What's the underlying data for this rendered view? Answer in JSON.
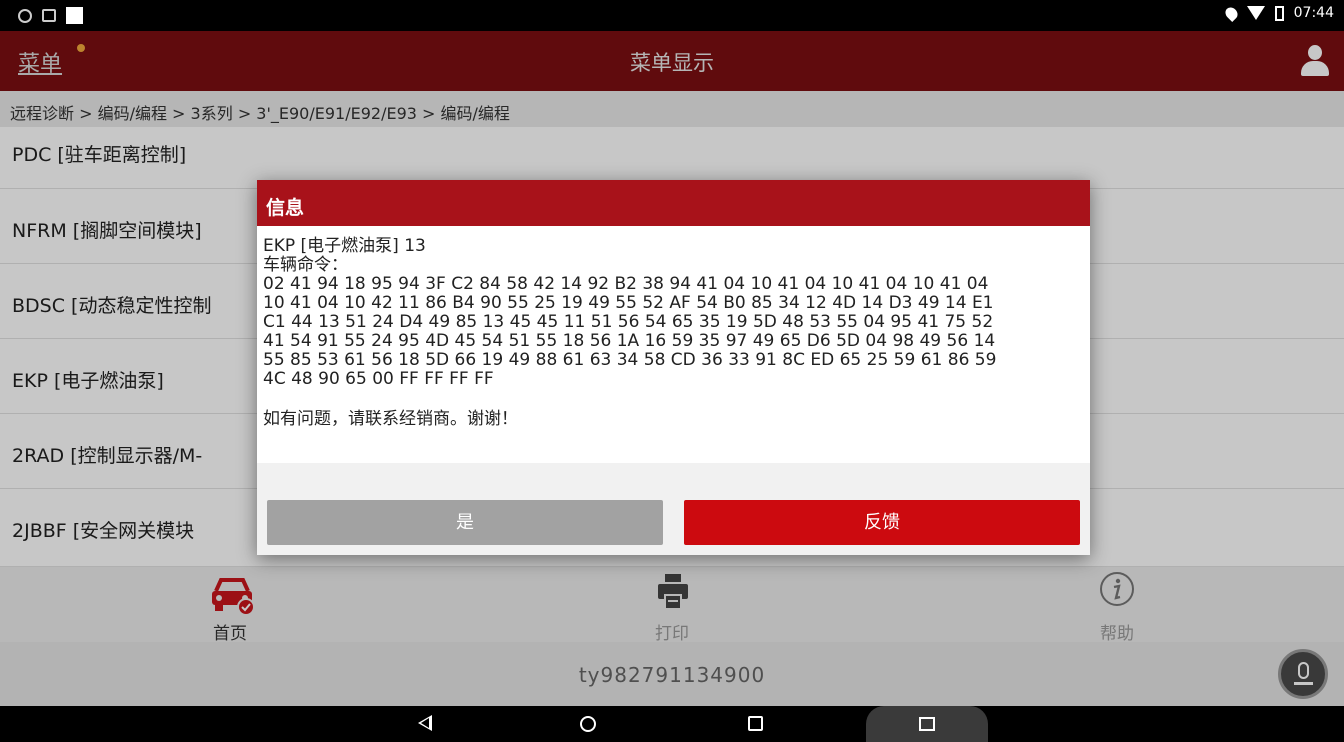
{
  "status_bar": {
    "time": "07:44"
  },
  "header": {
    "menu_label": "菜单",
    "title": "菜单显示"
  },
  "breadcrumb": "远程诊断 > 编码/编程 > 3系列 > 3'_E90/E91/E92/E93 > 编码/编程",
  "list_items": [
    "PDC [驻车距离控制]",
    "NFRM [搁脚空间模块]",
    "BDSC [动态稳定性控制",
    "EKP [电子燃油泵]",
    "2RAD [控制显示器/M-",
    "2JBBF [安全网关模块"
  ],
  "bottom_nav": {
    "home": "首页",
    "print": "打印",
    "help": "帮助"
  },
  "account": "ty982791134900",
  "dialog": {
    "title": "信息",
    "line1": "EKP [电子燃油泵] 13",
    "line2": "车辆命令：",
    "hex_lines": [
      "02 41 94 18 95 94 3F C2 84 58 42 14 92 B2 38 94 41 04 10 41 04 10 41 04 10 41 04",
      "10 41 04 10 42 11 86 B4 90 55 25 19 49 55 52 AF 54 B0 85 34 12 4D 14 D3 49 14 E1",
      "C1 44 13 51 24 D4 49 85 13 45 45 11 51 56 54 65 35 19 5D 48 53 55 04 95 41 75 52",
      "41 54 91 55 24 95 4D 45 54 51 55 18 56 1A 16 59 35 97 49 65 D6 5D 04 98 49 56 14",
      "55 85 53 61 56 18 5D 66 19 49 88 61 63 34 58 CD 36 33 91 8C ED 65 25 59 61 86 59",
      "4C 48 90 65 00 FF FF FF FF"
    ],
    "contact": "如有问题，请联系经销商。谢谢！",
    "yes_label": "是",
    "feedback_label": "反馈"
  },
  "colors": {
    "title_bar": "#7b0f11",
    "dialog_header": "#a8121a",
    "feedback_button": "#cc0a0f",
    "home_icon": "#c8151b"
  }
}
